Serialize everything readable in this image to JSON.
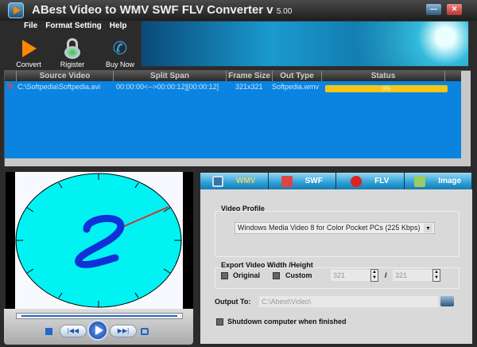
{
  "window": {
    "title": "ABest Video to WMV SWF FLV Converter v",
    "version": "5.00",
    "minimize_label": "—",
    "close_label": "✕"
  },
  "menu": [
    "File",
    "Format Setting",
    "Help"
  ],
  "toolbar": {
    "convert": "Convert",
    "register": "Rigister",
    "buy_now": "Buy Now"
  },
  "list": {
    "columns": [
      "Source Video",
      "Split Span",
      "Frame Size",
      "Out Type",
      "Status"
    ],
    "rows": [
      {
        "source": "C:\\Softpedia\\Softpedia.avi",
        "split_span": "00:00:00<-->00:00:12][00:00:12]",
        "frame_size": "321x321",
        "out_type": "Softpedia.wmv",
        "status": "0%",
        "progress": 0
      }
    ]
  },
  "player": {
    "prev_label": "|◀◀",
    "next_label": "▶▶|"
  },
  "tabs": [
    {
      "label": "WMV",
      "active": true,
      "color": "#e8d070"
    },
    {
      "label": "SWF",
      "color": "#ffffff"
    },
    {
      "label": "FLV",
      "color": "#ffffff"
    },
    {
      "label": "Image",
      "color": "#ffffff"
    }
  ],
  "settings": {
    "video_profile_label": "Video Profile",
    "video_profile_value": "Windows Media Video 8 for Color Pocket PCs (225 Kbps)",
    "export_label": "Export Video Width /Height",
    "original_label": "Original",
    "custom_label": "Custom",
    "width": "321",
    "height": "321",
    "separator": "/",
    "output_label": "Output To:",
    "output_path": "C:\\Abest\\Video\\",
    "shutdown_label": "Shutdown computer when finished"
  }
}
